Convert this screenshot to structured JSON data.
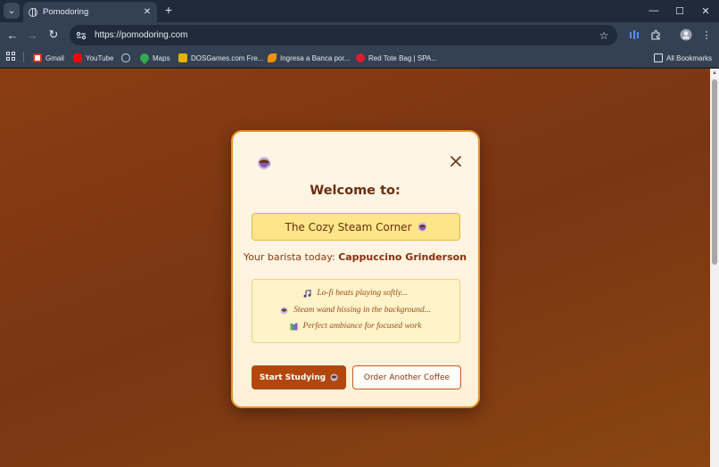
{
  "browser": {
    "tab": {
      "title": "Pomodoring",
      "close_icon": "close-icon"
    },
    "new_tab_label": "+",
    "address_bar": {
      "url": "https://pomodoring.com"
    },
    "window_controls": {
      "minimize": "—",
      "maximize": "☐",
      "close": "✕"
    },
    "bookmarks": [
      {
        "label": "Gmail",
        "icon": "gmail-icon",
        "color": "#d93025"
      },
      {
        "label": "YouTube",
        "icon": "youtube-icon",
        "color": "#ff0000"
      },
      {
        "label": "",
        "icon": "globe-icon",
        "color": "#c9d2dc"
      },
      {
        "label": "Maps",
        "icon": "maps-pin-icon",
        "color": "#34a853"
      },
      {
        "label": "DOSGames.com Fre...",
        "icon": "dosgames-icon",
        "color": "#e6b400"
      },
      {
        "label": "Ingresa a Banca por...",
        "icon": "banca-icon",
        "color": "#f39200"
      },
      {
        "label": "Red Tote Bag | SPA...",
        "icon": "red-tote-icon",
        "color": "#e11d2a"
      }
    ],
    "all_bookmarks": "All Bookmarks"
  },
  "modal": {
    "heading": "Welcome to:",
    "cafe_name": "The Cozy Steam Corner",
    "barista_prefix": "Your barista today:",
    "barista_name": "Cappuccino Grinderson",
    "ambience": [
      {
        "icon": "music-note-icon",
        "text": "Lo-fi beats playing softly..."
      },
      {
        "icon": "coffee-cup-icon",
        "text": "Steam wand hissing in the background..."
      },
      {
        "icon": "books-icon",
        "text": "Perfect ambiance for focused work"
      }
    ],
    "primary_button": "Start Studying",
    "secondary_button": "Order Another Coffee"
  },
  "colors": {
    "background": "#7a3513",
    "modal_border": "#e8922a",
    "heading": "#6b2e10",
    "cafe_box": "#fde68a",
    "primary_button": "#b2470d"
  }
}
